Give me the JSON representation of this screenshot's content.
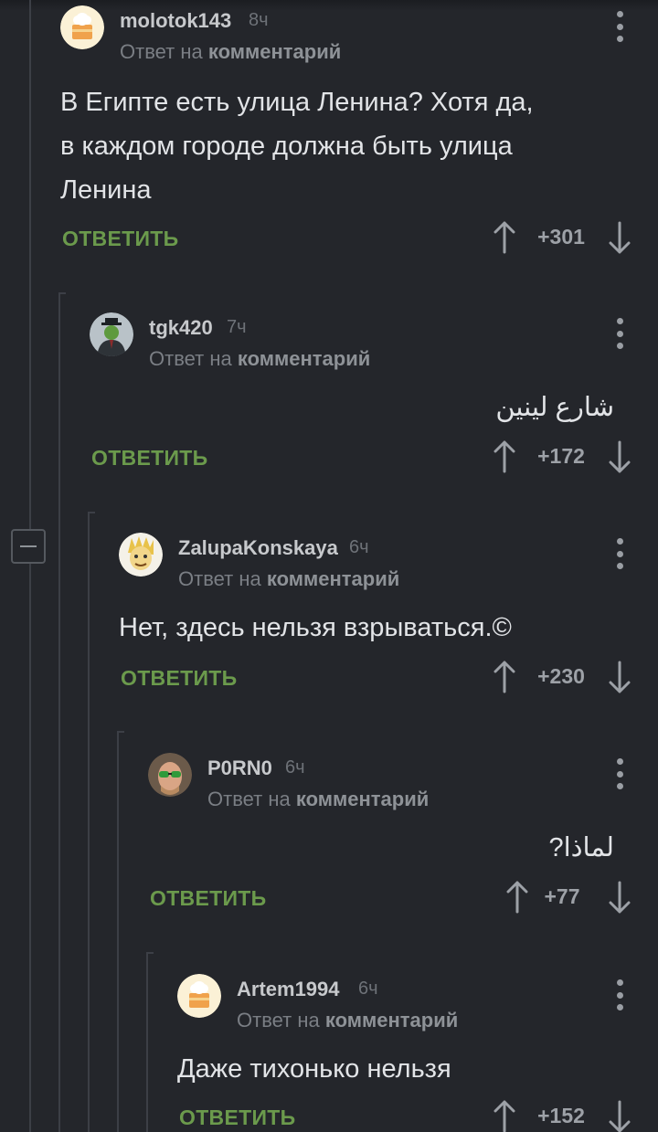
{
  "common": {
    "reply_to_prefix": "Ответ на",
    "reply_to_link": "комментарий",
    "reply_button": "ОТВЕТИТЬ"
  },
  "colors": {
    "background": "#24262b",
    "reply_button": "#6b9a4c",
    "thread_line": "#3c3f46"
  },
  "collapse_button": {
    "icon": "minus-icon"
  },
  "comments": [
    {
      "username": "molotok143",
      "time": "8ч",
      "avatar": "default-cake-avatar",
      "text": [
        "В Египте есть улица Ленина? Хотя да,",
        "в каждом городе должна быть улица",
        "Ленина"
      ],
      "rating": "+301"
    },
    {
      "username": "tgk420",
      "time": "7ч",
      "avatar": "man-with-apple-avatar",
      "text": [
        "شارع لينين"
      ],
      "rating": "+172"
    },
    {
      "username": "ZalupaKonskaya",
      "time": "6ч",
      "avatar": "cartoon-character-avatar",
      "text": [
        "Нет, здесь нельзя взрываться.©"
      ],
      "rating": "+230"
    },
    {
      "username": "P0RN0",
      "time": "6ч",
      "avatar": "man-with-sunglasses-avatar",
      "text": [
        "لماذا?"
      ],
      "rating": "+77"
    },
    {
      "username": "Artem1994",
      "time": "6ч",
      "avatar": "default-cake-avatar",
      "text": [
        "Даже тихонько нельзя"
      ],
      "rating": "+152"
    }
  ]
}
